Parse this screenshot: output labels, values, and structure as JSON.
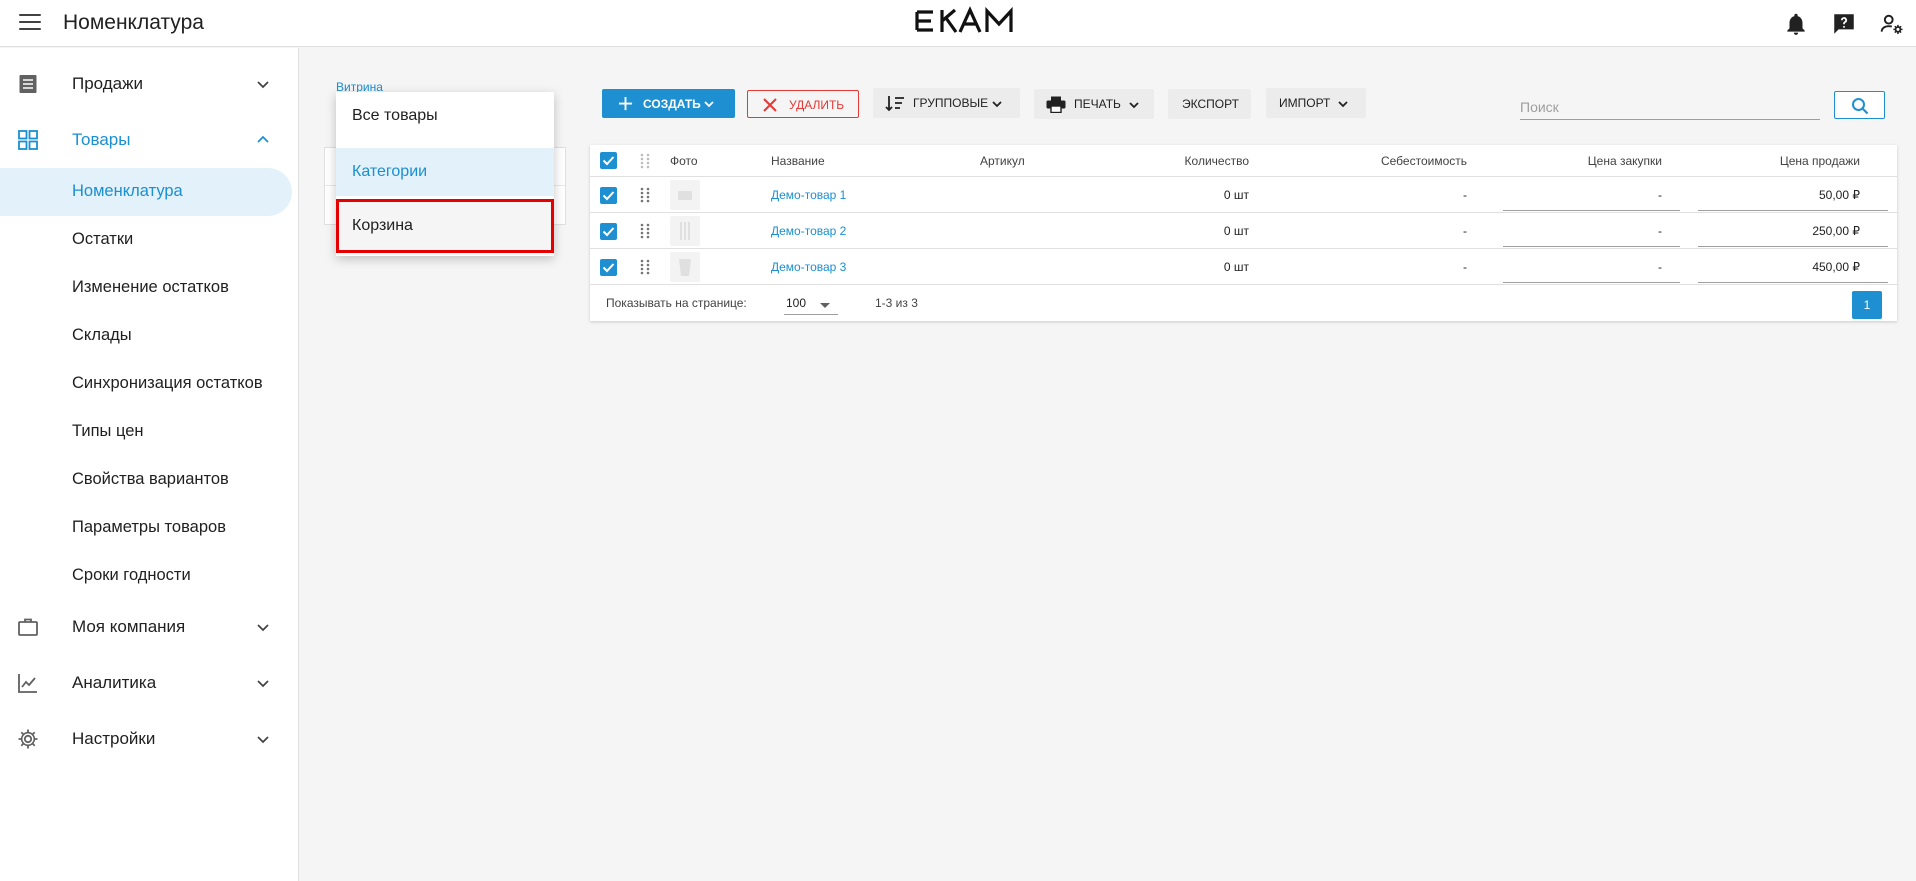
{
  "app": {
    "title": "Номенклатура",
    "logo_text": "EKAM"
  },
  "sidebar": {
    "groups": [
      {
        "label": "Продажи",
        "icon": "receipt-icon"
      },
      {
        "label": "Товары",
        "icon": "grid-icon"
      },
      {
        "label": "Моя компания",
        "icon": "briefcase-icon"
      },
      {
        "label": "Аналитика",
        "icon": "chart-icon"
      },
      {
        "label": "Настройки",
        "icon": "gear-icon"
      }
    ],
    "sub_items": [
      {
        "label": "Номенклатура"
      },
      {
        "label": "Остатки"
      },
      {
        "label": "Изменение остатков"
      },
      {
        "label": "Склады"
      },
      {
        "label": "Синхронизация остатков"
      },
      {
        "label": "Типы цен"
      },
      {
        "label": "Свойства вариантов"
      },
      {
        "label": "Параметры товаров"
      },
      {
        "label": "Сроки годности"
      }
    ]
  },
  "breadcrumb": "Витрина",
  "dropdown": {
    "items": [
      {
        "label": "Все товары"
      },
      {
        "label": "Категории"
      },
      {
        "label": "Корзина"
      }
    ]
  },
  "toolbar": {
    "create": "СОЗДАТЬ",
    "delete": "УДАЛИТЬ",
    "group": "ГРУППОВЫЕ",
    "print": "ПЕЧАТЬ",
    "export": "ЭКСПОРТ",
    "import": "ИМПОРТ",
    "search_placeholder": "Поиск"
  },
  "table": {
    "columns": [
      "Фото",
      "Название",
      "Артикул",
      "Количество",
      "Себестоимость",
      "Цена закупки",
      "Цена продажи"
    ],
    "rows": [
      {
        "name": "Демо-товар 1",
        "sku": "",
        "qty": "0 шт",
        "cost": "-",
        "purchase": "-",
        "price": "50,00 ₽"
      },
      {
        "name": "Демо-товар 2",
        "sku": "",
        "qty": "0 шт",
        "cost": "-",
        "purchase": "-",
        "price": "250,00 ₽"
      },
      {
        "name": "Демо-товар 3",
        "sku": "",
        "qty": "0 шт",
        "cost": "-",
        "purchase": "-",
        "price": "450,00 ₽"
      }
    ],
    "footer": {
      "per_page_label": "Показывать на странице:",
      "per_page": "100",
      "range": "1-3 из 3",
      "page": "1"
    }
  },
  "colors": {
    "accent": "#1e90d2",
    "link": "#1a8fd1",
    "danger": "#e53935",
    "highlight": "#e60000"
  }
}
